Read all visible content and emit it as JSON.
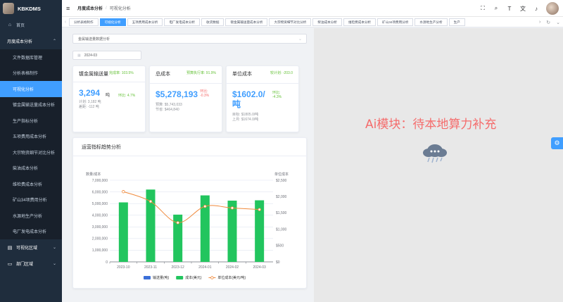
{
  "app": {
    "name": "KBKDMS"
  },
  "sidebar": {
    "home": "首页",
    "group_monthly": "月度成本分析",
    "items": [
      {
        "label": "文件数据库管理"
      },
      {
        "label": "分析表格制作"
      },
      {
        "label": "可视化分析"
      },
      {
        "label": "镀金属输送量成本分析"
      },
      {
        "label": "生产指标分析"
      },
      {
        "label": "五项费用成本分析"
      },
      {
        "label": "大宗物资细节对比分析"
      },
      {
        "label": "柴油成本分析"
      },
      {
        "label": "维检费成本分析"
      },
      {
        "label": "矿山34项费用分析"
      },
      {
        "label": "水源地生产分析"
      },
      {
        "label": "电厂发电成本分析"
      }
    ],
    "group_visual": "可视化区域",
    "group_dept": "部门区域"
  },
  "header": {
    "breadcrumb_1": "月度成本分析",
    "breadcrumb_sep": "/",
    "breadcrumb_2": "可视化分析"
  },
  "tags": [
    {
      "label": "分析表格制作",
      "active": false
    },
    {
      "label": "可视化分析",
      "active": true
    },
    {
      "label": "五项费用成本分析",
      "active": false
    },
    {
      "label": "电厂发电成本分析",
      "active": false
    },
    {
      "label": "收货数据",
      "active": false
    },
    {
      "label": "镀金属输送量成本分析",
      "active": false
    },
    {
      "label": "大宗物资细节对比分析",
      "active": false
    },
    {
      "label": "柴油成本分析",
      "active": false
    },
    {
      "label": "维检费成本分析",
      "active": false
    },
    {
      "label": "矿山34项费用分析",
      "active": false
    },
    {
      "label": "水源地生产分析",
      "active": false
    },
    {
      "label": "生产",
      "active": false
    }
  ],
  "filters": {
    "dataset": "金属输送量数据分析",
    "month": "2024-03"
  },
  "cards": [
    {
      "title": "镀金属输送量",
      "top_info": "完成率: 103.5%",
      "value": "3,294",
      "unit": "吨",
      "compare_label": "环比: 4.7%",
      "sub1": "计划: 3,182 吨",
      "sub2": "差距: -112 吨"
    },
    {
      "title": "总成本",
      "top_info": "预算执行率: 91.9%",
      "value": "$5,278,193",
      "unit": "元",
      "compare_label": "环比: -0.3%",
      "sub1": "预算: $5,743,033",
      "sub2": "节省: $464,840"
    },
    {
      "title": "单位成本",
      "top_info": "较计划: -203.0",
      "value": "$1602.0/吨",
      "unit": "",
      "compare_label": "环比: -4.3%",
      "sub1": "目标: $1805.0/吨",
      "sub2": "上月: $1674.0/吨"
    }
  ],
  "chart_title": "运营指标趋势分析",
  "chart_data": {
    "type": "bar",
    "categories": [
      "2023-10",
      "2023-11",
      "2023-12",
      "2024-01",
      "2024-02",
      "2024-03"
    ],
    "ylabel_left": "数量/成本",
    "ylabel_right": "单位成本",
    "ylim_left": [
      0,
      7000000
    ],
    "ylim_right": [
      0,
      2500
    ],
    "left_ticks": [
      "0",
      "1,000,000",
      "2,000,000",
      "3,000,000",
      "4,000,000",
      "5,000,000",
      "6,000,000",
      "7,000,000"
    ],
    "right_ticks": [
      "$0",
      "$500",
      "$1,000",
      "$1,500",
      "$2,000",
      "$2,500"
    ],
    "series": [
      {
        "name": "输送量(吨)",
        "type": "bar",
        "color": "#3b6fd8",
        "values": [
          3150,
          3250,
          3050,
          3200,
          3150,
          3294
        ]
      },
      {
        "name": "成本(美元)",
        "type": "bar",
        "color": "#22c55e",
        "values": [
          5100000,
          6200000,
          4050000,
          5700000,
          5250000,
          5278193
        ]
      },
      {
        "name": "单位成本(美元/吨)",
        "type": "line",
        "color": "#f08a3c",
        "values": [
          2150,
          1850,
          1200,
          1700,
          1650,
          1602
        ]
      }
    ],
    "legend_position": "bottom"
  },
  "ai_panel": {
    "text": "Ai模块：待本地算力补充"
  }
}
